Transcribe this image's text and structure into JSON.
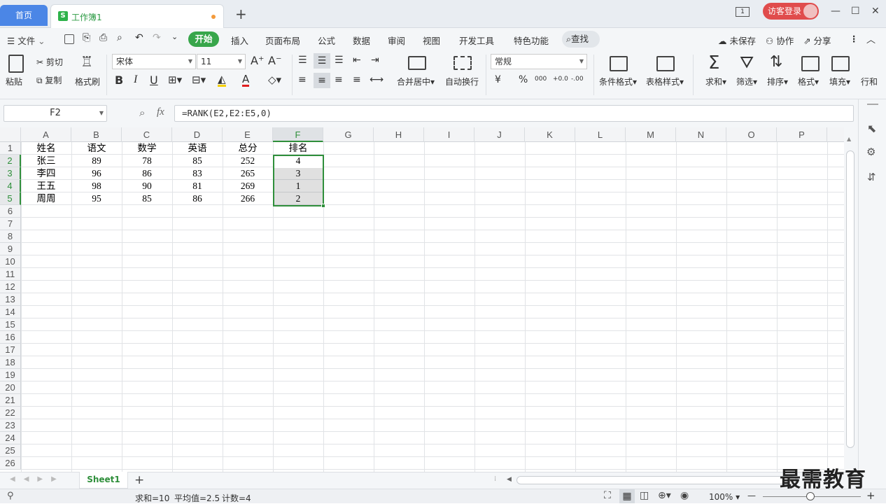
{
  "titlebar": {
    "home_tab": "首页",
    "doc_tab": "工作簿1",
    "doc_logo": "S",
    "add_tab": "+",
    "window_count": "1",
    "visitor_login": "访客登录",
    "minimize": "—",
    "maximize": "☐",
    "close": "✕"
  },
  "menubar": {
    "file": "文件",
    "tabs": [
      "开始",
      "插入",
      "页面布局",
      "公式",
      "数据",
      "审阅",
      "视图",
      "开发工具",
      "特色功能"
    ],
    "find": "查找",
    "unsaved": "未保存",
    "collab": "协作",
    "share": "分享"
  },
  "ribbon": {
    "paste": "粘贴",
    "cut": "剪切",
    "copy": "复制",
    "format_painter": "格式刷",
    "font_name": "宋体",
    "font_size": "11",
    "bold": "B",
    "italic": "I",
    "underline": "U",
    "font_color_letter": "A",
    "merge_center": "合并居中",
    "auto_wrap": "自动换行",
    "number_format": "常规",
    "currency": "¥",
    "percent": "%",
    "thousands": "000",
    "inc_decimal": "+0.0",
    "dec_decimal": "-.00",
    "cond_format": "条件格式",
    "table_style": "表格样式",
    "sum": "求和",
    "filter": "筛选",
    "sort": "排序",
    "format": "格式",
    "fill": "填充",
    "rowcol": "行和"
  },
  "formula_bar": {
    "name_box": "F2",
    "fx": "fx",
    "formula": "=RANK(E2,E2:E5,0)"
  },
  "grid": {
    "columns": [
      "A",
      "B",
      "C",
      "D",
      "E",
      "F",
      "G",
      "H",
      "I",
      "J",
      "K",
      "L",
      "M",
      "N",
      "O",
      "P"
    ],
    "selected_column": "F",
    "rows": [
      "1",
      "2",
      "3",
      "4",
      "5",
      "6",
      "7",
      "8",
      "9",
      "10",
      "11",
      "12",
      "13",
      "14",
      "15",
      "16",
      "17",
      "18",
      "19",
      "20",
      "21",
      "22",
      "23",
      "24",
      "25",
      "26"
    ],
    "header": [
      "姓名",
      "语文",
      "数学",
      "英语",
      "总分",
      "排名"
    ],
    "data": [
      [
        "张三",
        "89",
        "78",
        "85",
        "252",
        "4"
      ],
      [
        "李四",
        "96",
        "86",
        "83",
        "265",
        "3"
      ],
      [
        "王五",
        "98",
        "90",
        "81",
        "269",
        "1"
      ],
      [
        "周周",
        "95",
        "85",
        "86",
        "266",
        "2"
      ]
    ]
  },
  "sheets": {
    "active": "Sheet1",
    "add": "+"
  },
  "status": {
    "sum": "求和=10",
    "average": "平均值=2.5",
    "count": "计数=4",
    "zoom": "100%",
    "zoom_minus": "—",
    "zoom_plus": "+"
  },
  "watermark": "最需教育"
}
